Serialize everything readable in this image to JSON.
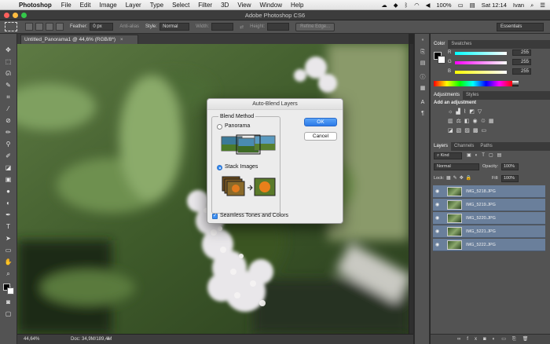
{
  "menubar": {
    "app_name": "Photoshop",
    "items": [
      "File",
      "Edit",
      "Image",
      "Layer",
      "Type",
      "Select",
      "Filter",
      "3D",
      "View",
      "Window",
      "Help"
    ],
    "battery": "100%",
    "clock": "Sat 12:14",
    "user": "Ivan"
  },
  "window": {
    "title": "Adobe Photoshop CS6"
  },
  "options_bar": {
    "feather_label": "Feather:",
    "feather_value": "0 px",
    "antialias_label": "Anti-alias",
    "style_label": "Style:",
    "style_value": "Normal",
    "width_label": "Width:",
    "height_label": "Height:",
    "refine_edge_label": "Refine Edge...",
    "workspace_value": "Essentials"
  },
  "document": {
    "tab_label": "Untitled_Panorama1 @ 44,6% (RGB/8*)",
    "zoom": "44,64%",
    "doc_size": "Doc: 34,9M/189,4M"
  },
  "panels": {
    "color_tabs": [
      "Color",
      "Swatches"
    ],
    "color_rows": [
      {
        "label": "R",
        "value": "255"
      },
      {
        "label": "G",
        "value": "255"
      },
      {
        "label": "B",
        "value": "255"
      }
    ],
    "adjustments_tabs": [
      "Adjustments",
      "Styles"
    ],
    "add_adjustment_label": "Add an adjustment",
    "layers_tabs": [
      "Layers",
      "Channels",
      "Paths"
    ],
    "kind_filter": "Kind",
    "blend_mode": "Normal",
    "opacity_label": "Opacity:",
    "opacity_value": "100%",
    "lock_label": "Lock:",
    "fill_label": "Fill:",
    "fill_value": "100%",
    "layers": [
      "IMG_5218.JPG",
      "IMG_5219.JPG",
      "IMG_5220.JPG",
      "IMG_5221.JPG",
      "IMG_5222.JPG"
    ]
  },
  "dialog": {
    "title": "Auto-Blend Layers",
    "group_label": "Blend Method",
    "panorama_label": "Panorama",
    "stack_images_label": "Stack Images",
    "seamless_label": "Seamless Tones and Colors",
    "ok_label": "OK",
    "cancel_label": "Cancel",
    "selected_method": "Stack Images",
    "seamless_checked": true
  },
  "colors": {
    "dialog_ok_blue": "#2c7ae8",
    "layer_selected": "#6a7f9b",
    "panel_bg": "#535353"
  }
}
